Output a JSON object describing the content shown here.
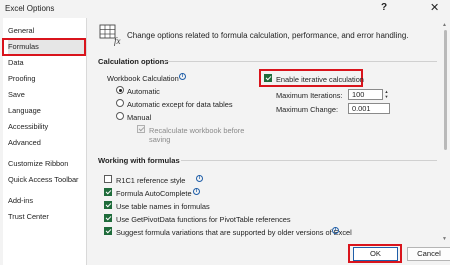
{
  "window": {
    "title": "Excel Options",
    "help": "?",
    "close": "✕"
  },
  "sidebar": {
    "items": [
      {
        "label": "General"
      },
      {
        "label": "Formulas"
      },
      {
        "label": "Data"
      },
      {
        "label": "Proofing"
      },
      {
        "label": "Save"
      },
      {
        "label": "Language"
      },
      {
        "label": "Accessibility"
      },
      {
        "label": "Advanced"
      },
      {
        "label": "Customize Ribbon"
      },
      {
        "label": "Quick Access Toolbar"
      },
      {
        "label": "Add-ins"
      },
      {
        "label": "Trust Center"
      }
    ],
    "selected": "Formulas"
  },
  "header": {
    "intro": "Change options related to formula calculation, performance, and error handling."
  },
  "calculation": {
    "title": "Calculation options",
    "workbook_label": "Workbook Calculation",
    "automatic": "Automatic",
    "automatic_except": "Automatic except for data tables",
    "manual": "Manual",
    "recalc": "Recalculate workbook before",
    "recalc2": "saving",
    "enable_iterative": "Enable iterative calculation",
    "max_iter_label": "Maximum Iterations:",
    "max_iter_value": "100",
    "max_change_label": "Maximum Change:",
    "max_change_value": "0.001"
  },
  "formulas": {
    "title": "Working with formulas",
    "r1c1": "R1C1 reference style",
    "autocomplete": "Formula AutoComplete",
    "table_names": "Use table names in formulas",
    "getpivot": "Use GetPivotData functions for PivotTable references",
    "suggest": "Suggest formula variations that are supported by older versions of Excel"
  },
  "buttons": {
    "ok": "OK",
    "cancel": "Cancel"
  },
  "colors": {
    "highlight": "#d9141c",
    "checkbox": "#1e6b3a",
    "info": "#1f5ea8"
  }
}
